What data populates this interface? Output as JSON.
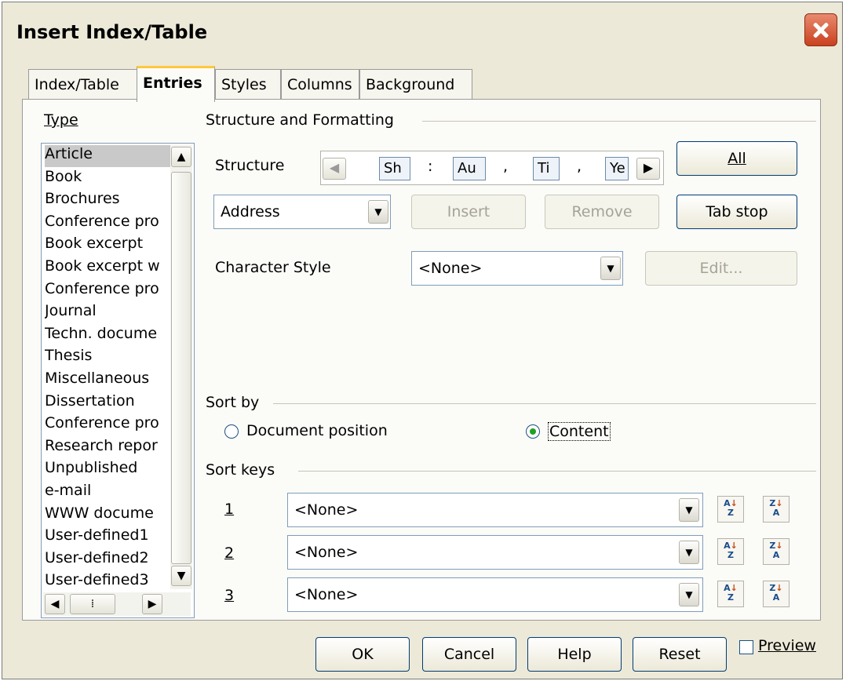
{
  "window": {
    "title": "Insert Index/Table"
  },
  "tabs": [
    {
      "label": "Index/Table"
    },
    {
      "label": "Entries"
    },
    {
      "label": "Styles"
    },
    {
      "label": "Columns"
    },
    {
      "label": "Background"
    }
  ],
  "type_section": {
    "label": "Type",
    "items": [
      "Article",
      "Book",
      "Brochures",
      "Conference pro",
      "Book excerpt",
      "Book excerpt w",
      "Conference pro",
      "Journal",
      "Techn. docume",
      "Thesis",
      "Miscellaneous",
      "Dissertation",
      "Conference pro",
      "Research repor",
      "Unpublished",
      "e-mail",
      "WWW docume",
      "User-defined1",
      "User-defined2",
      "User-defined3"
    ],
    "selected": "Article"
  },
  "structure": {
    "section_label": "Structure and Formatting",
    "label": "Structure",
    "tokens": [
      "Sh",
      ":",
      "Au",
      ",",
      "Ti",
      ",",
      "Ye"
    ],
    "all_button": "All",
    "field_select": "Address",
    "insert_button": "Insert",
    "remove_button": "Remove",
    "tab_stop_button": "Tab stop",
    "char_style_label": "Character Style",
    "char_style_value": "<None>",
    "edit_button": "Edit..."
  },
  "sort_by": {
    "section_label": "Sort by",
    "option_document": "Document position",
    "option_content": "Content",
    "selected": "Content"
  },
  "sort_keys": {
    "section_label": "Sort keys",
    "keys": [
      {
        "num": "1",
        "value": "<None>"
      },
      {
        "num": "2",
        "value": "<None>"
      },
      {
        "num": "3",
        "value": "<None>"
      }
    ]
  },
  "footer": {
    "ok": "OK",
    "cancel": "Cancel",
    "help": "Help",
    "reset": "Reset",
    "preview": "Preview",
    "preview_checked": false
  },
  "colors": {
    "accent_tab": "#ffc83c",
    "button_border": "#003c74",
    "radio_on": "#21a121"
  }
}
